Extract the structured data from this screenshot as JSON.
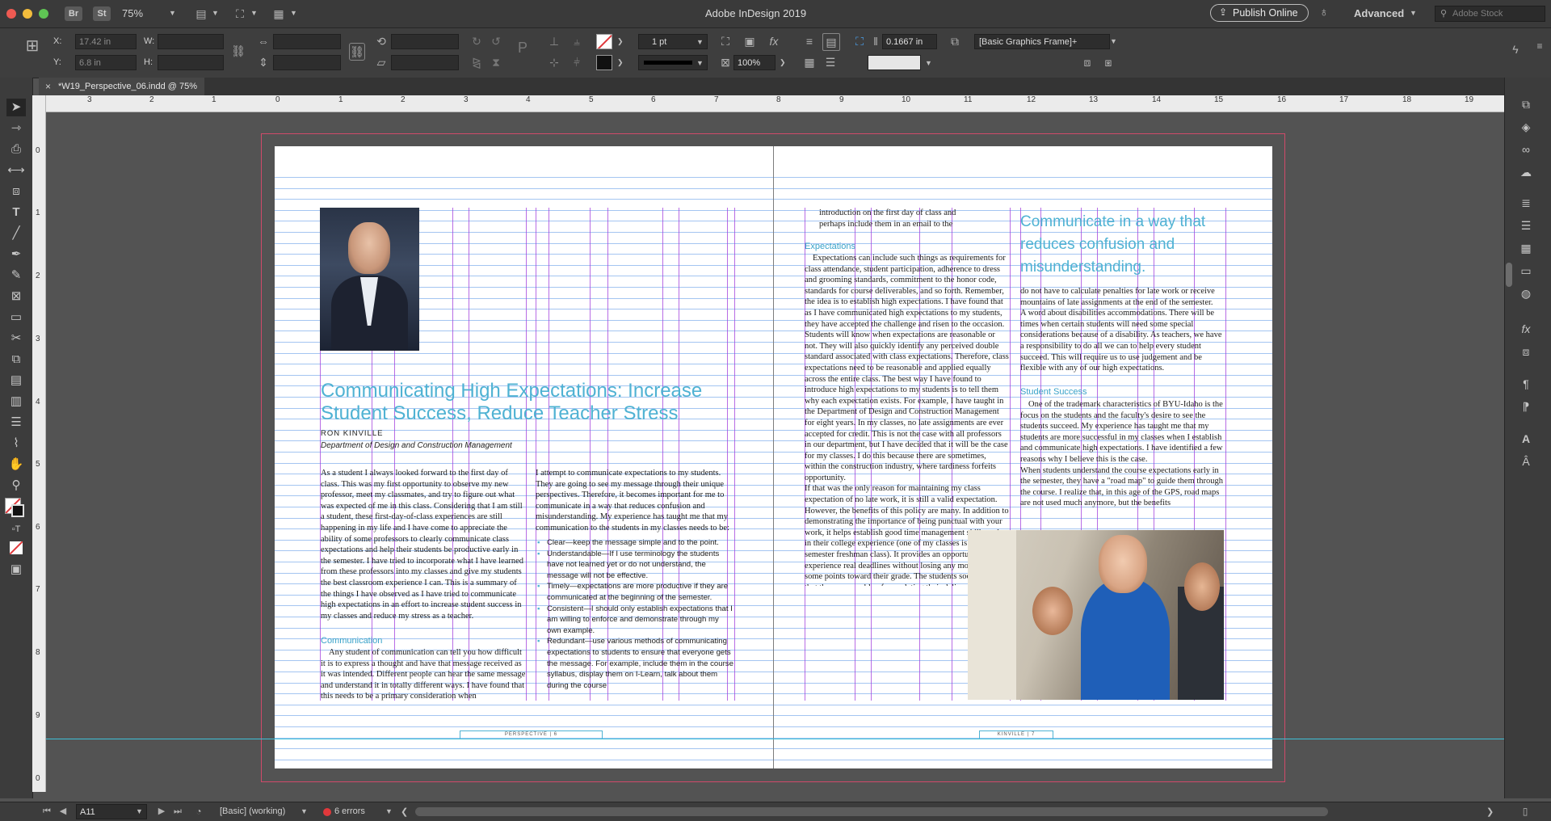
{
  "titlebar": {
    "app_badges": [
      "Br",
      "St"
    ],
    "zoom": "75%",
    "title": "Adobe InDesign 2019",
    "publish": "Publish Online",
    "workspace": "Advanced",
    "search_placeholder": "Adobe Stock"
  },
  "control": {
    "x_label": "X:",
    "y_label": "Y:",
    "w_label": "W:",
    "h_label": "H:",
    "x_value": "17.42 in",
    "y_value": "6.8 in",
    "stroke_weight": "1 pt",
    "scale": "100%",
    "gap": "0.1667 in",
    "object_style": "[Basic Graphics Frame]+"
  },
  "document_tab": {
    "title": "*W19_Perspective_06.indd @ 75%",
    "close": "×"
  },
  "rulers": {
    "horizontal": [
      "3",
      "2",
      "1",
      "0",
      "1",
      "2",
      "3",
      "4",
      "5",
      "6",
      "7",
      "8",
      "9",
      "10",
      "11",
      "12",
      "13",
      "14",
      "15",
      "16",
      "17",
      "18",
      "19"
    ],
    "vertical": [
      "0",
      "1",
      "2",
      "3",
      "4",
      "5",
      "6",
      "7",
      "8",
      "9",
      "0"
    ]
  },
  "statusbar": {
    "page": "A11",
    "preflight_profile": "[Basic] (working)",
    "errors": "6 errors"
  },
  "colors": {
    "accent": "#4fb2d3",
    "margin_guide": "#d14a6a",
    "column_guide": "#9b3fd8",
    "baseline_grid": "#5a96e6",
    "error": "#e0383b"
  },
  "spread": {
    "left": {
      "title": "Communicating High Expectations: Increase Student Success, Reduce Teacher Stress",
      "author": "RON KINVILLE",
      "department": "Department of Design and Construction Management",
      "col1_text": "As a student I always looked forward to the first day of class. This was my first opportunity to observe my new professor, meet my classmates, and try to figure out what was expected of me in this class. Considering that I am still a student, these first-day-of-class experiences are still happening in my life and I have come to appreciate the ability of some professors to clearly communicate class expectations and help their students be productive early in the semester. I have tried to incorporate what I have learned from these professors into my classes and give my students the best classroom experience I can. This is a summary of the things I have observed as I have tried to communicate high expectations in an effort to increase student success in my classes and reduce my stress as a teacher.",
      "communication_head": "Communication",
      "communication_text": "Any student of communication can tell you how difficult it is to express a thought and have that message received as it was intended. Different people can hear the same message and understand it in totally different ways. I have found that this needs to be a primary consideration when",
      "col2_text": "I attempt to communicate expectations to my students. They are going to see my message through their unique perspectives. Therefore, it becomes important for me to communicate in a way that reduces confusion and misunderstanding. My experience has taught me that my communication to the students in my classes needs to be:",
      "bullets": [
        "Clear—keep the message simple and to the point.",
        "Understandable—If I use terminology the students have not learned yet or do not understand, the message will not be effective.",
        "Timely—expectations are more productive if they are communicated at the beginning of the semester.",
        "Consistent—I should only establish expectations that I am willing to enforce and demonstrate through my own example.",
        "Redundant—use various methods of communicating expectations to students to ensure that everyone gets the message. For example, include them in the course syllabus, display them on I-Learn, talk about them during the course"
      ],
      "folio": "PERSPECTIVE | 6"
    },
    "right": {
      "top_text": "introduction on the first day of class and perhaps include them in an email to the students.",
      "expectations_head": "Expectations",
      "col1_text": "Expectations can include such things as requirements for class attendance, student participation, adherence to dress and grooming standards, commitment to the honor code, standards for course deliverables, and so forth. Remember, the idea is to establish high expectations. I have found that as I have communicated high expectations to my students, they have accepted the challenge and risen to the occasion.\nStudents will know when expectations are reasonable or not. They will also quickly identify any perceived double standard associated with class expectations. Therefore, class expectations need to be reasonable and applied equally across the entire class. The best way I have found to introduce high expectations to my students is to tell them why each expectation exists. For example, I have taught in the Department of Design and Construction Management for eight years. In my classes, no late assignments are ever accepted for credit. This is not the case with all professors in our department, but I have decided that it will be the case for my classes. I do this because there are sometimes, within the construction industry, where tardiness forfeits opportunity.\nIf that was the only reason for maintaining my class expectation of no late work, it is still a valid expectation. However, the benefits of this policy are many. In addition to demonstrating the importance of being punctual with your work, it helps establish good time management skills early in their college experience (one of my classes is a first-semester freshman class). It provides an opportunity to experience real deadlines without losing any more than some points toward their grade. The students soon realize that they are capable of completing their deliverables within the given time requirements. This expectation also reduces stress on the teacher. I do not have to worry about which excuses are valid for late work and which are not. I",
      "pull_quote": "Communicate in a way that reduces confusion and misunderstanding.",
      "col2_text": "do not have to calculate penalties for late work or receive mountains of late assignments at the end of the semester.\nA word about disabilities accommodations. There will be times when certain students will need some special considerations because of a disability. As teachers, we have a responsibility to do all we can to help every student succeed. This will require us to use judgement and be flexible with any of our high expectations.",
      "student_success_head": "Student Success",
      "col2_text_b": "One of the trademark characteristics of BYU-Idaho is the focus on the students and the faculty's desire to see the students succeed. My experience has taught me that my students are more successful in my classes when I establish and communicate high expectations. I have identified a few reasons why I believe this is the case.\nWhen students understand the course expectations early in the semester, they have a \"road map\" to guide them through the course. I realize that, in this age of the GPS, road maps are not used much anymore, but the benefits",
      "folio": "KINVILLE | 7"
    }
  }
}
